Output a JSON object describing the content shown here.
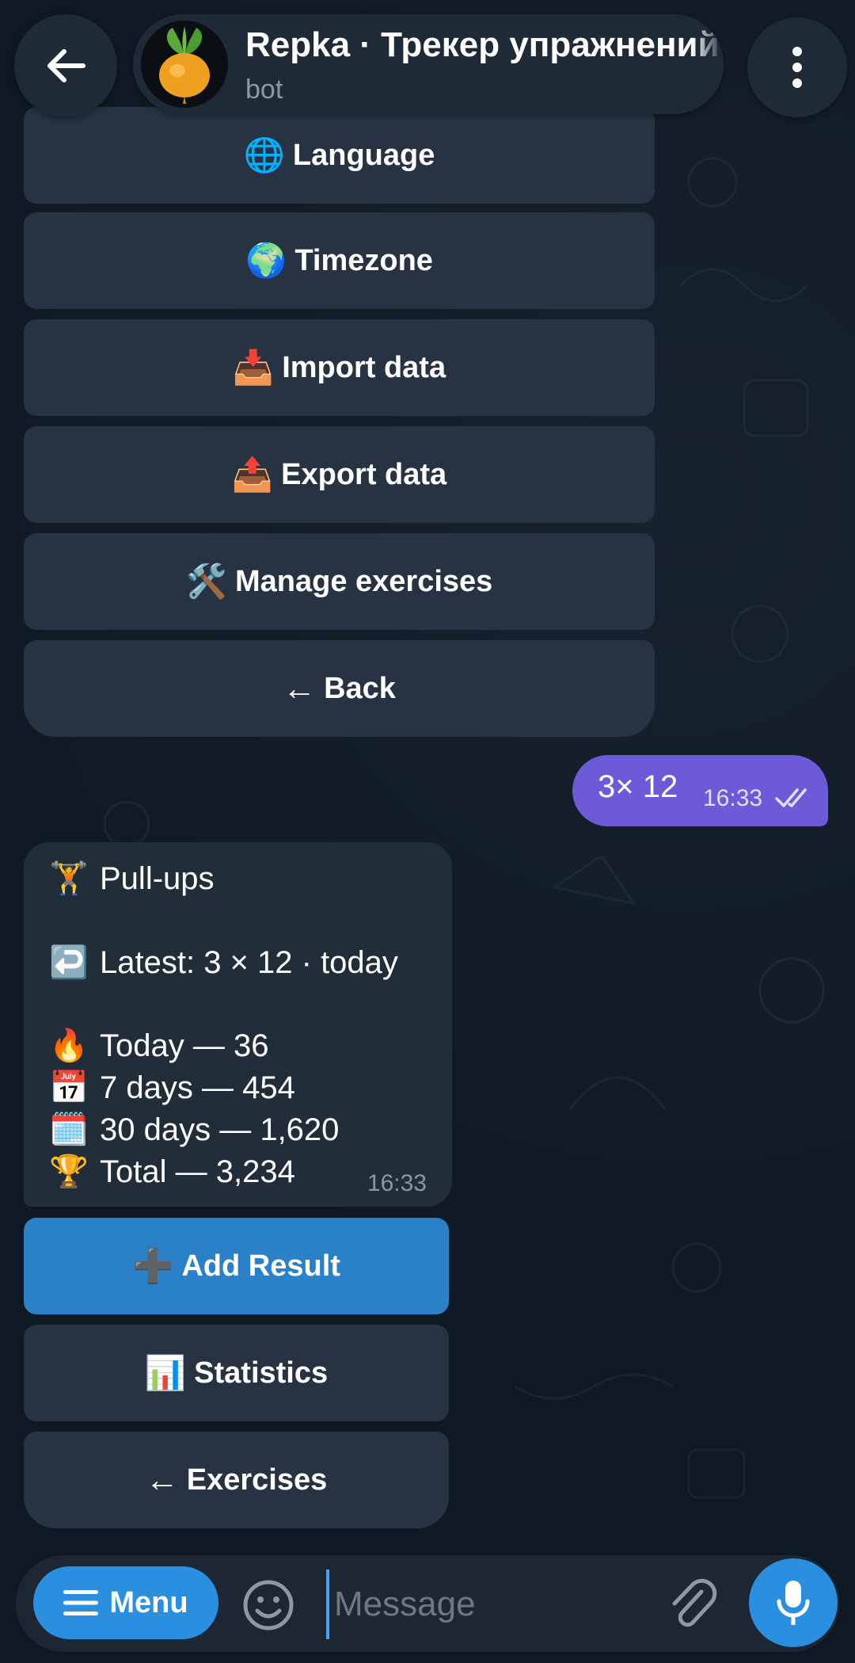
{
  "header": {
    "title": "Repka · Трекер упражнений",
    "subtitle": "bot"
  },
  "settings_keyboard": [
    {
      "emoji": "🌐",
      "label": "Language"
    },
    {
      "emoji": "🌍",
      "label": "Timezone"
    },
    {
      "emoji": "📥",
      "label": "Import data"
    },
    {
      "emoji": "📤",
      "label": "Export data"
    },
    {
      "emoji": "🛠️",
      "label": "Manage exercises"
    },
    {
      "emoji": "←",
      "label": "Back"
    }
  ],
  "outgoing_message": {
    "text": "3× 12",
    "time": "16:33",
    "status": "read"
  },
  "incoming_message": {
    "title_emoji": "🏋️",
    "title": "Pull-ups",
    "latest_emoji": "↩️",
    "latest": "Latest: 3 × 12 · today",
    "stats": [
      {
        "emoji": "🔥",
        "text": "Today — 36"
      },
      {
        "emoji": "📅",
        "text": "7 days — 454"
      },
      {
        "emoji": "🗓️",
        "text": "30 days — 1,620"
      },
      {
        "emoji": "🏆",
        "text": "Total — 3,234"
      }
    ],
    "time": "16:33"
  },
  "exercise_keyboard": [
    {
      "emoji": "➕",
      "label": "Add Result"
    },
    {
      "emoji": "📊",
      "label": "Statistics"
    },
    {
      "emoji": "←",
      "label": "Exercises"
    }
  ],
  "input_bar": {
    "menu_label": "Menu",
    "placeholder": "Message"
  },
  "colors": {
    "background": "#0f1923",
    "outgoing_bubble": "#6d5ad8",
    "primary_button": "#2b81c7",
    "accent": "#2b8fe0"
  }
}
